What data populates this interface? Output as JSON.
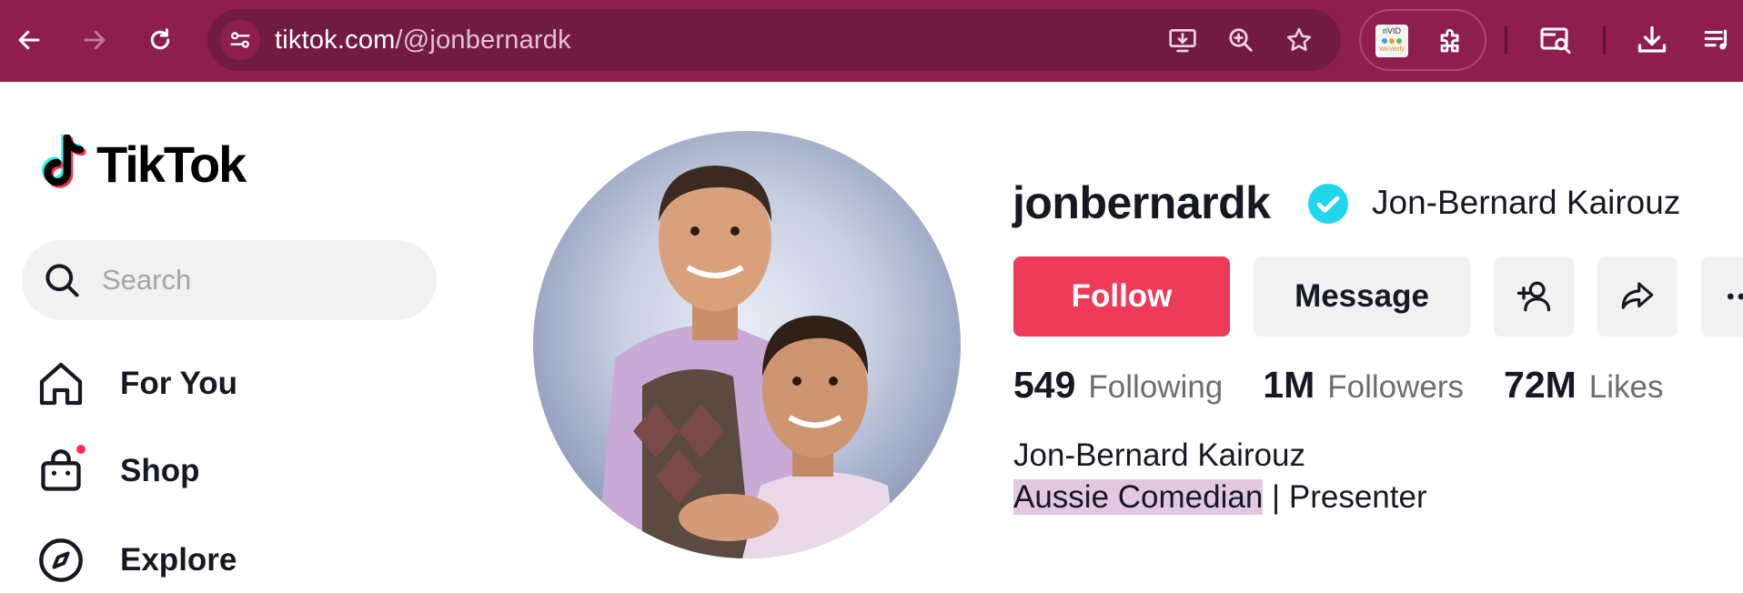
{
  "browser": {
    "url_domain": "tiktok.com",
    "url_path": "/@jonbernardk",
    "extension_label": "nVID",
    "extension_sub": "WeVerify",
    "icons": [
      "back-arrow-icon",
      "forward-arrow-icon",
      "reload-icon",
      "tune-icon",
      "install-app-icon",
      "zoom-icon",
      "star-icon",
      "puzzle-icon",
      "tab-search-icon",
      "download-icon",
      "reading-list-icon"
    ]
  },
  "sidebar": {
    "logo_text": "TikTok",
    "search_placeholder": "Search",
    "items": [
      {
        "label": "For You",
        "icon": "home-icon"
      },
      {
        "label": "Shop",
        "icon": "shopping-bag-icon"
      },
      {
        "label": "Explore",
        "icon": "compass-icon"
      }
    ]
  },
  "profile": {
    "username": "jonbernardk",
    "nickname": "Jon-Bernard Kairouz",
    "verified": true,
    "follow_label": "Follow",
    "message_label": "Message",
    "stats": [
      {
        "value": "549",
        "label": "Following"
      },
      {
        "value": "1M",
        "label": "Followers"
      },
      {
        "value": "72M",
        "label": "Likes"
      }
    ],
    "bio_line1": "Jon-Bernard Kairouz",
    "bio_highlight": "Aussie Comedian",
    "bio_rest": " | Presenter"
  },
  "colors": {
    "chrome": "#8e1e4d",
    "follow": "#ee3b59",
    "verified": "#20d5ec"
  }
}
